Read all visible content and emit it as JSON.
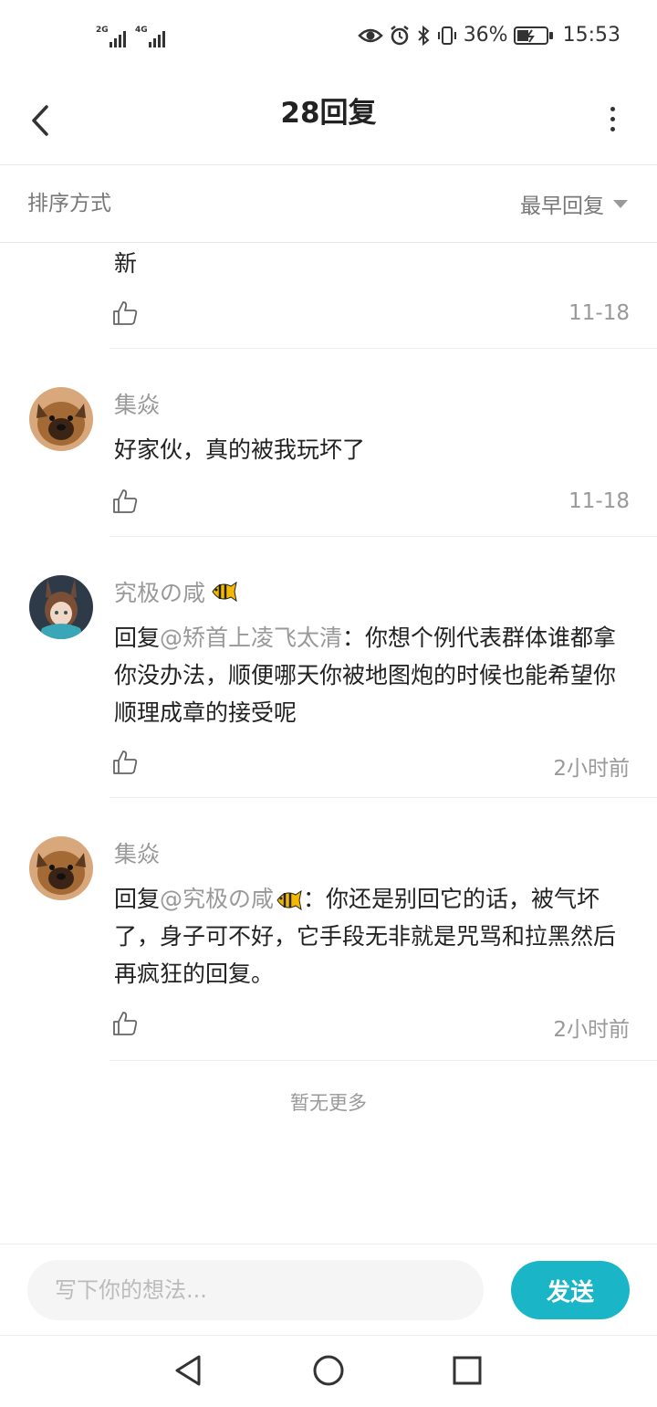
{
  "status": {
    "net1": "2G",
    "net2": "4G",
    "battery_pct": "36%",
    "time": "15:53"
  },
  "header": {
    "title": "28回复",
    "back_icon": "chevron-left-icon",
    "more_icon": "more-vertical-icon"
  },
  "sort": {
    "label": "排序方式",
    "selected": "最早回复"
  },
  "comments": [
    {
      "text": "新",
      "time": "11-18"
    },
    {
      "username": "集焱",
      "text": "好家伙，真的被我玩坏了",
      "time": "11-18"
    },
    {
      "username": "究极の咸",
      "reply_prefix": "回复",
      "mention": "@矫首上凌飞太清",
      "text": "：你想个例代表群体谁都拿你没办法，顺便哪天你被地图炮的时候也能希望你顺理成章的接受呢",
      "time": "2小时前"
    },
    {
      "username": "集焱",
      "reply_prefix": "回复",
      "mention": "@究极の咸",
      "text": "：你还是别回它的话，被气坏了，身子可不好，它手段无非就是咒骂和拉黑然后再疯狂的回复。",
      "time": "2小时前"
    }
  ],
  "footer_note": "暂无更多",
  "composer": {
    "placeholder": "写下你的想法...",
    "send_label": "发送",
    "accent": "#1ab5c6"
  }
}
